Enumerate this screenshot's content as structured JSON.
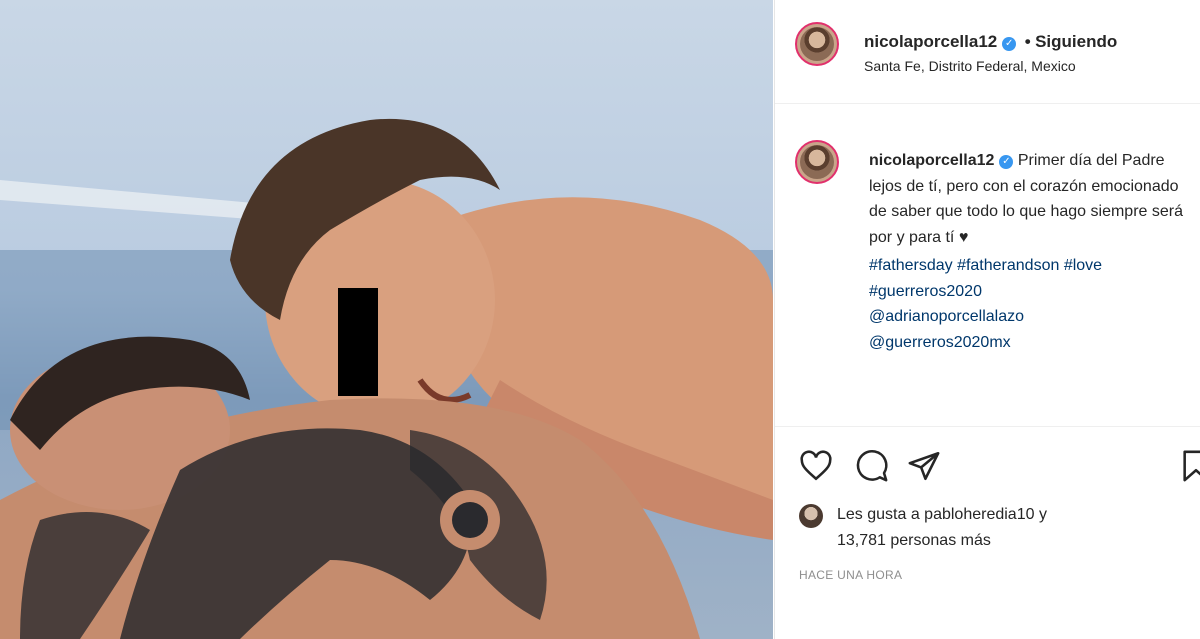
{
  "post": {
    "username": "nicolaporcella12",
    "separator": "•",
    "follow_status": "Siguiendo",
    "location": "Santa Fe, Distrito Federal, Mexico",
    "caption_text": "Primer día del Padre lejos de tí, pero con el corazón emocionado de saber que todo lo que hago siempre será por y para tí ♥",
    "hashtags": [
      "#fathersday",
      "#fatherandson",
      "#love",
      "#guerreros2020"
    ],
    "mentions": [
      "@adrianoporcellalazo",
      "@guerreros2020mx"
    ],
    "likes_line1": "Les gusta a pabloheredia10 y",
    "likes_line2": "13,781 personas más",
    "timestamp": "HACE UNA HORA"
  },
  "icons": {
    "like": "heart-icon",
    "comment": "comment-icon",
    "share": "share-icon",
    "save": "bookmark-icon",
    "verified": "verified-badge-icon"
  },
  "colors": {
    "accent_ring": "#e1306c",
    "verified": "#3897f0",
    "link": "#00376b",
    "meta": "#8e8e8e"
  }
}
